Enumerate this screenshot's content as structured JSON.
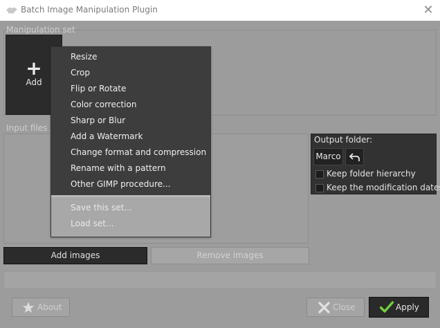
{
  "window": {
    "title": "Batch Image Manipulation Plugin",
    "close_glyph": "✕"
  },
  "manipulation": {
    "label": "Manipulation set",
    "add_icon": "+",
    "add_label": "Add"
  },
  "menu": {
    "items": [
      {
        "label": "Resize"
      },
      {
        "label": "Crop"
      },
      {
        "label": "Flip or Rotate"
      },
      {
        "label": "Color correction"
      },
      {
        "label": "Sharp or Blur"
      },
      {
        "label": "Add a Watermark"
      },
      {
        "label": "Change format and compression"
      },
      {
        "label": "Rename with a pattern"
      },
      {
        "label": "Other GIMP procedure..."
      }
    ],
    "extra_items": [
      {
        "label": "Save this set..."
      },
      {
        "label": "Load set..."
      }
    ]
  },
  "input": {
    "label": "Input files a",
    "add_images": "Add images",
    "remove_images": "Remove images"
  },
  "output": {
    "label": "Output folder:",
    "folder_button": "Marco",
    "undo_icon": "undo-arrow-icon",
    "keep_hierarchy": "Keep folder hierarchy",
    "keep_hierarchy_checked": false,
    "keep_dates": "Keep the modification dates",
    "keep_dates_checked": false
  },
  "footer": {
    "about": "About",
    "close": "Close",
    "apply": "Apply"
  },
  "colors": {
    "background": "#9c9c9c",
    "dark_panel": "#3d3d3d",
    "apply_check": "#6fd13c"
  }
}
